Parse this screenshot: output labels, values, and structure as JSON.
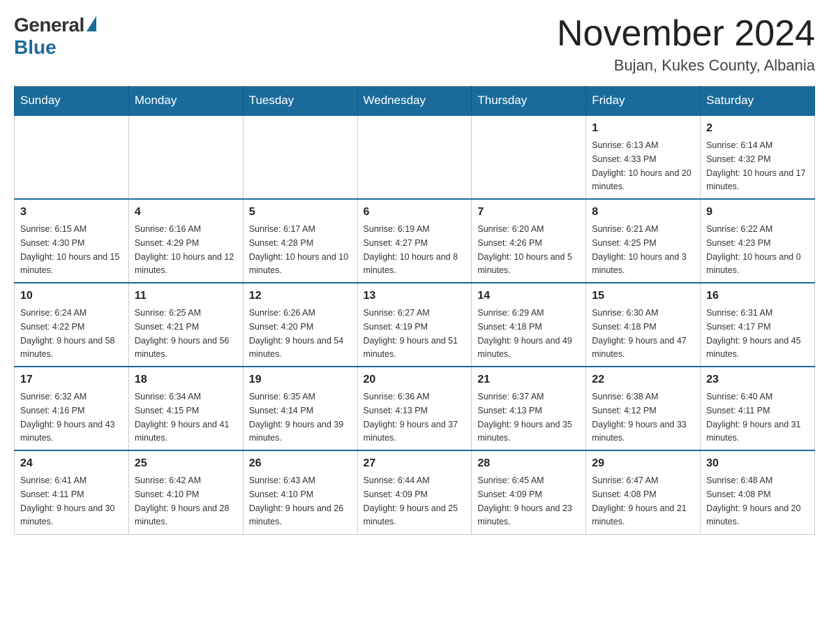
{
  "header": {
    "logo": {
      "general": "General",
      "blue": "Blue"
    },
    "title": "November 2024",
    "subtitle": "Bujan, Kukes County, Albania"
  },
  "weekdays": [
    "Sunday",
    "Monday",
    "Tuesday",
    "Wednesday",
    "Thursday",
    "Friday",
    "Saturday"
  ],
  "weeks": [
    [
      {
        "day": "",
        "info": ""
      },
      {
        "day": "",
        "info": ""
      },
      {
        "day": "",
        "info": ""
      },
      {
        "day": "",
        "info": ""
      },
      {
        "day": "",
        "info": ""
      },
      {
        "day": "1",
        "info": "Sunrise: 6:13 AM\nSunset: 4:33 PM\nDaylight: 10 hours and 20 minutes."
      },
      {
        "day": "2",
        "info": "Sunrise: 6:14 AM\nSunset: 4:32 PM\nDaylight: 10 hours and 17 minutes."
      }
    ],
    [
      {
        "day": "3",
        "info": "Sunrise: 6:15 AM\nSunset: 4:30 PM\nDaylight: 10 hours and 15 minutes."
      },
      {
        "day": "4",
        "info": "Sunrise: 6:16 AM\nSunset: 4:29 PM\nDaylight: 10 hours and 12 minutes."
      },
      {
        "day": "5",
        "info": "Sunrise: 6:17 AM\nSunset: 4:28 PM\nDaylight: 10 hours and 10 minutes."
      },
      {
        "day": "6",
        "info": "Sunrise: 6:19 AM\nSunset: 4:27 PM\nDaylight: 10 hours and 8 minutes."
      },
      {
        "day": "7",
        "info": "Sunrise: 6:20 AM\nSunset: 4:26 PM\nDaylight: 10 hours and 5 minutes."
      },
      {
        "day": "8",
        "info": "Sunrise: 6:21 AM\nSunset: 4:25 PM\nDaylight: 10 hours and 3 minutes."
      },
      {
        "day": "9",
        "info": "Sunrise: 6:22 AM\nSunset: 4:23 PM\nDaylight: 10 hours and 0 minutes."
      }
    ],
    [
      {
        "day": "10",
        "info": "Sunrise: 6:24 AM\nSunset: 4:22 PM\nDaylight: 9 hours and 58 minutes."
      },
      {
        "day": "11",
        "info": "Sunrise: 6:25 AM\nSunset: 4:21 PM\nDaylight: 9 hours and 56 minutes."
      },
      {
        "day": "12",
        "info": "Sunrise: 6:26 AM\nSunset: 4:20 PM\nDaylight: 9 hours and 54 minutes."
      },
      {
        "day": "13",
        "info": "Sunrise: 6:27 AM\nSunset: 4:19 PM\nDaylight: 9 hours and 51 minutes."
      },
      {
        "day": "14",
        "info": "Sunrise: 6:29 AM\nSunset: 4:18 PM\nDaylight: 9 hours and 49 minutes."
      },
      {
        "day": "15",
        "info": "Sunrise: 6:30 AM\nSunset: 4:18 PM\nDaylight: 9 hours and 47 minutes."
      },
      {
        "day": "16",
        "info": "Sunrise: 6:31 AM\nSunset: 4:17 PM\nDaylight: 9 hours and 45 minutes."
      }
    ],
    [
      {
        "day": "17",
        "info": "Sunrise: 6:32 AM\nSunset: 4:16 PM\nDaylight: 9 hours and 43 minutes."
      },
      {
        "day": "18",
        "info": "Sunrise: 6:34 AM\nSunset: 4:15 PM\nDaylight: 9 hours and 41 minutes."
      },
      {
        "day": "19",
        "info": "Sunrise: 6:35 AM\nSunset: 4:14 PM\nDaylight: 9 hours and 39 minutes."
      },
      {
        "day": "20",
        "info": "Sunrise: 6:36 AM\nSunset: 4:13 PM\nDaylight: 9 hours and 37 minutes."
      },
      {
        "day": "21",
        "info": "Sunrise: 6:37 AM\nSunset: 4:13 PM\nDaylight: 9 hours and 35 minutes."
      },
      {
        "day": "22",
        "info": "Sunrise: 6:38 AM\nSunset: 4:12 PM\nDaylight: 9 hours and 33 minutes."
      },
      {
        "day": "23",
        "info": "Sunrise: 6:40 AM\nSunset: 4:11 PM\nDaylight: 9 hours and 31 minutes."
      }
    ],
    [
      {
        "day": "24",
        "info": "Sunrise: 6:41 AM\nSunset: 4:11 PM\nDaylight: 9 hours and 30 minutes."
      },
      {
        "day": "25",
        "info": "Sunrise: 6:42 AM\nSunset: 4:10 PM\nDaylight: 9 hours and 28 minutes."
      },
      {
        "day": "26",
        "info": "Sunrise: 6:43 AM\nSunset: 4:10 PM\nDaylight: 9 hours and 26 minutes."
      },
      {
        "day": "27",
        "info": "Sunrise: 6:44 AM\nSunset: 4:09 PM\nDaylight: 9 hours and 25 minutes."
      },
      {
        "day": "28",
        "info": "Sunrise: 6:45 AM\nSunset: 4:09 PM\nDaylight: 9 hours and 23 minutes."
      },
      {
        "day": "29",
        "info": "Sunrise: 6:47 AM\nSunset: 4:08 PM\nDaylight: 9 hours and 21 minutes."
      },
      {
        "day": "30",
        "info": "Sunrise: 6:48 AM\nSunset: 4:08 PM\nDaylight: 9 hours and 20 minutes."
      }
    ]
  ],
  "colors": {
    "header_bg": "#1a6b9a",
    "header_text": "#ffffff",
    "border": "#999999",
    "accent_blue": "#1a6b9a"
  }
}
